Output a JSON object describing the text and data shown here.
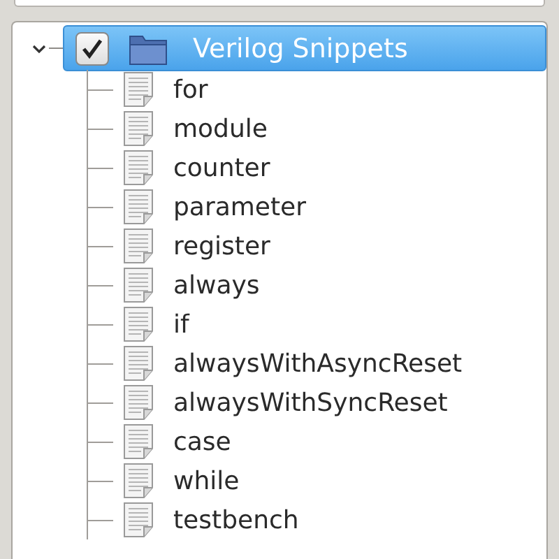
{
  "tree": {
    "root": {
      "label": "Verilog Snippets",
      "expanded": true,
      "checked": true,
      "selected": true,
      "children": [
        {
          "label": "for"
        },
        {
          "label": "module"
        },
        {
          "label": "counter"
        },
        {
          "label": "parameter"
        },
        {
          "label": "register"
        },
        {
          "label": "always"
        },
        {
          "label": "if"
        },
        {
          "label": "alwaysWithAsyncReset"
        },
        {
          "label": "alwaysWithSyncReset"
        },
        {
          "label": "case"
        },
        {
          "label": "while"
        },
        {
          "label": "testbench"
        }
      ]
    }
  }
}
